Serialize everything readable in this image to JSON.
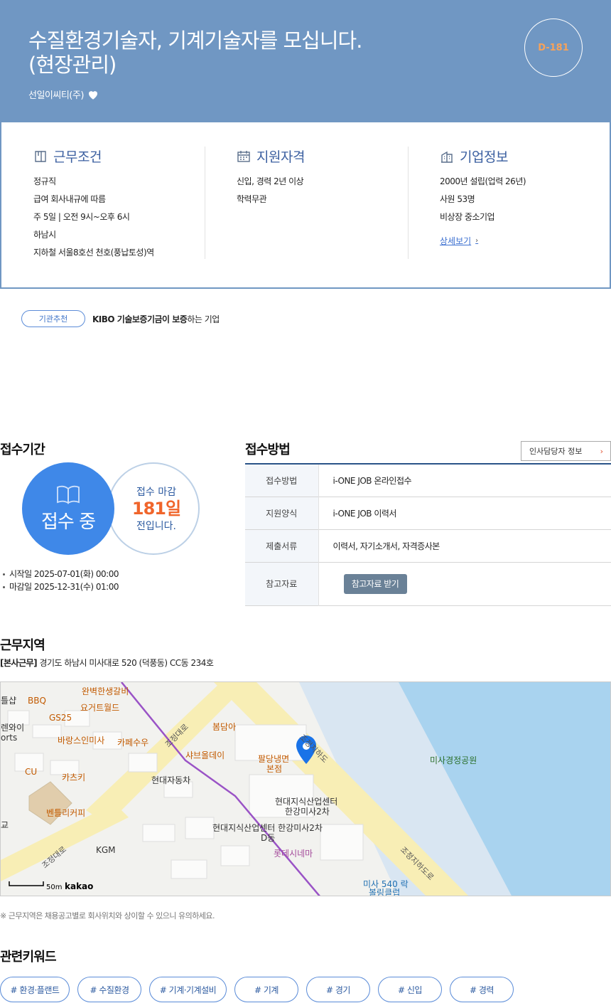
{
  "header": {
    "title": "수질환경기술자, 기계기술자를 모십니다.\n(현장관리)",
    "company": "선일이씨티(주)",
    "dday": "D-181"
  },
  "work_conditions": {
    "heading": "근무조건",
    "items": [
      "정규직",
      "급여 회사내규에 따름",
      "주 5일 | 오전 9시~오후 6시",
      "하남시",
      "지하철 서울8호선 천호(풍납토성)역"
    ]
  },
  "qualifications": {
    "heading": "지원자격",
    "items": [
      "신입, 경력 2년 이상",
      "학력무관"
    ]
  },
  "company_info": {
    "heading": "기업정보",
    "items": [
      "2000년 설립(업력 26년)",
      "사원 53명",
      "비상장 중소기업"
    ],
    "more_label": "상세보기"
  },
  "recommendation": {
    "badge": "기관추천",
    "text_bold": "KIBO 기술보증기금이 보증",
    "text_rest": "하는 기업"
  },
  "period": {
    "heading": "접수기간",
    "status": "접수 중",
    "deadline_line1": "접수 마감",
    "deadline_days": "181일",
    "deadline_line3": "전입니다.",
    "start": "시작일 2025-07-01(화) 00:00",
    "end": "마감일 2025-12-31(수) 01:00"
  },
  "method": {
    "heading": "접수방법",
    "hr_button": "인사담당자 정보",
    "rows": [
      {
        "label": "접수방법",
        "value": "i-ONE JOB 온라인접수"
      },
      {
        "label": "지원양식",
        "value": "i-ONE JOB 이력서"
      },
      {
        "label": "제출서류",
        "value": "이력서, 자기소개서, 자격증사본"
      }
    ],
    "ref_label": "참고자료",
    "ref_button": "참고자료 받기"
  },
  "location": {
    "heading": "근무지역",
    "addr_tag": "[본사근무]",
    "address": "경기도 하남시 미사대로 520 (덕풍동) CC동 234호",
    "note": "※ 근무지역은 채용공고별로 회사위치와 상이할 수 있으니 유의하세요.",
    "map": {
      "labels": {
        "p1": "완벽한생갈비",
        "p2": "BBQ",
        "p3": "요거트월드",
        "p4": "GS25",
        "p5": "바랑스인미사",
        "p6": "카페수우",
        "p7": "CU",
        "p8": "카츠키",
        "p9": "벤틀리커피",
        "p10": "KGM",
        "p11": "현대자동차",
        "p12": "봄담아",
        "p13": "샤브올데이",
        "p14": "팔당냉면",
        "p14b": "본점",
        "p15": "현대지식산업센터",
        "p15b": "한강미사2차",
        "p16": "현대지식산업센터 한강미사2차",
        "p16b": "D동",
        "p17": "롯데시네마",
        "p18": "미사경정공원",
        "p19": "미사 540 락",
        "p19b": "볼링클럽",
        "r1": "조정대로",
        "r2": "조정대로",
        "r3": "조정지하도",
        "r4": "조정지하도로",
        "e1": "틀샵",
        "e2": "렌와이",
        "e3": "orts",
        "e4": "교"
      },
      "scale": "50m",
      "brand": "kakao"
    }
  },
  "keywords": {
    "heading": "관련키워드",
    "items": [
      "# 환경·플랜트",
      "# 수질환경",
      "# 기계·기계설비",
      "# 기계",
      "# 경기",
      "# 신입",
      "# 경력"
    ]
  },
  "colors": {
    "header_bg": "#7097c3",
    "accent_blue": "#3f88e8",
    "deadline_orange": "#f0652b",
    "dday_orange": "#f7a25a"
  }
}
